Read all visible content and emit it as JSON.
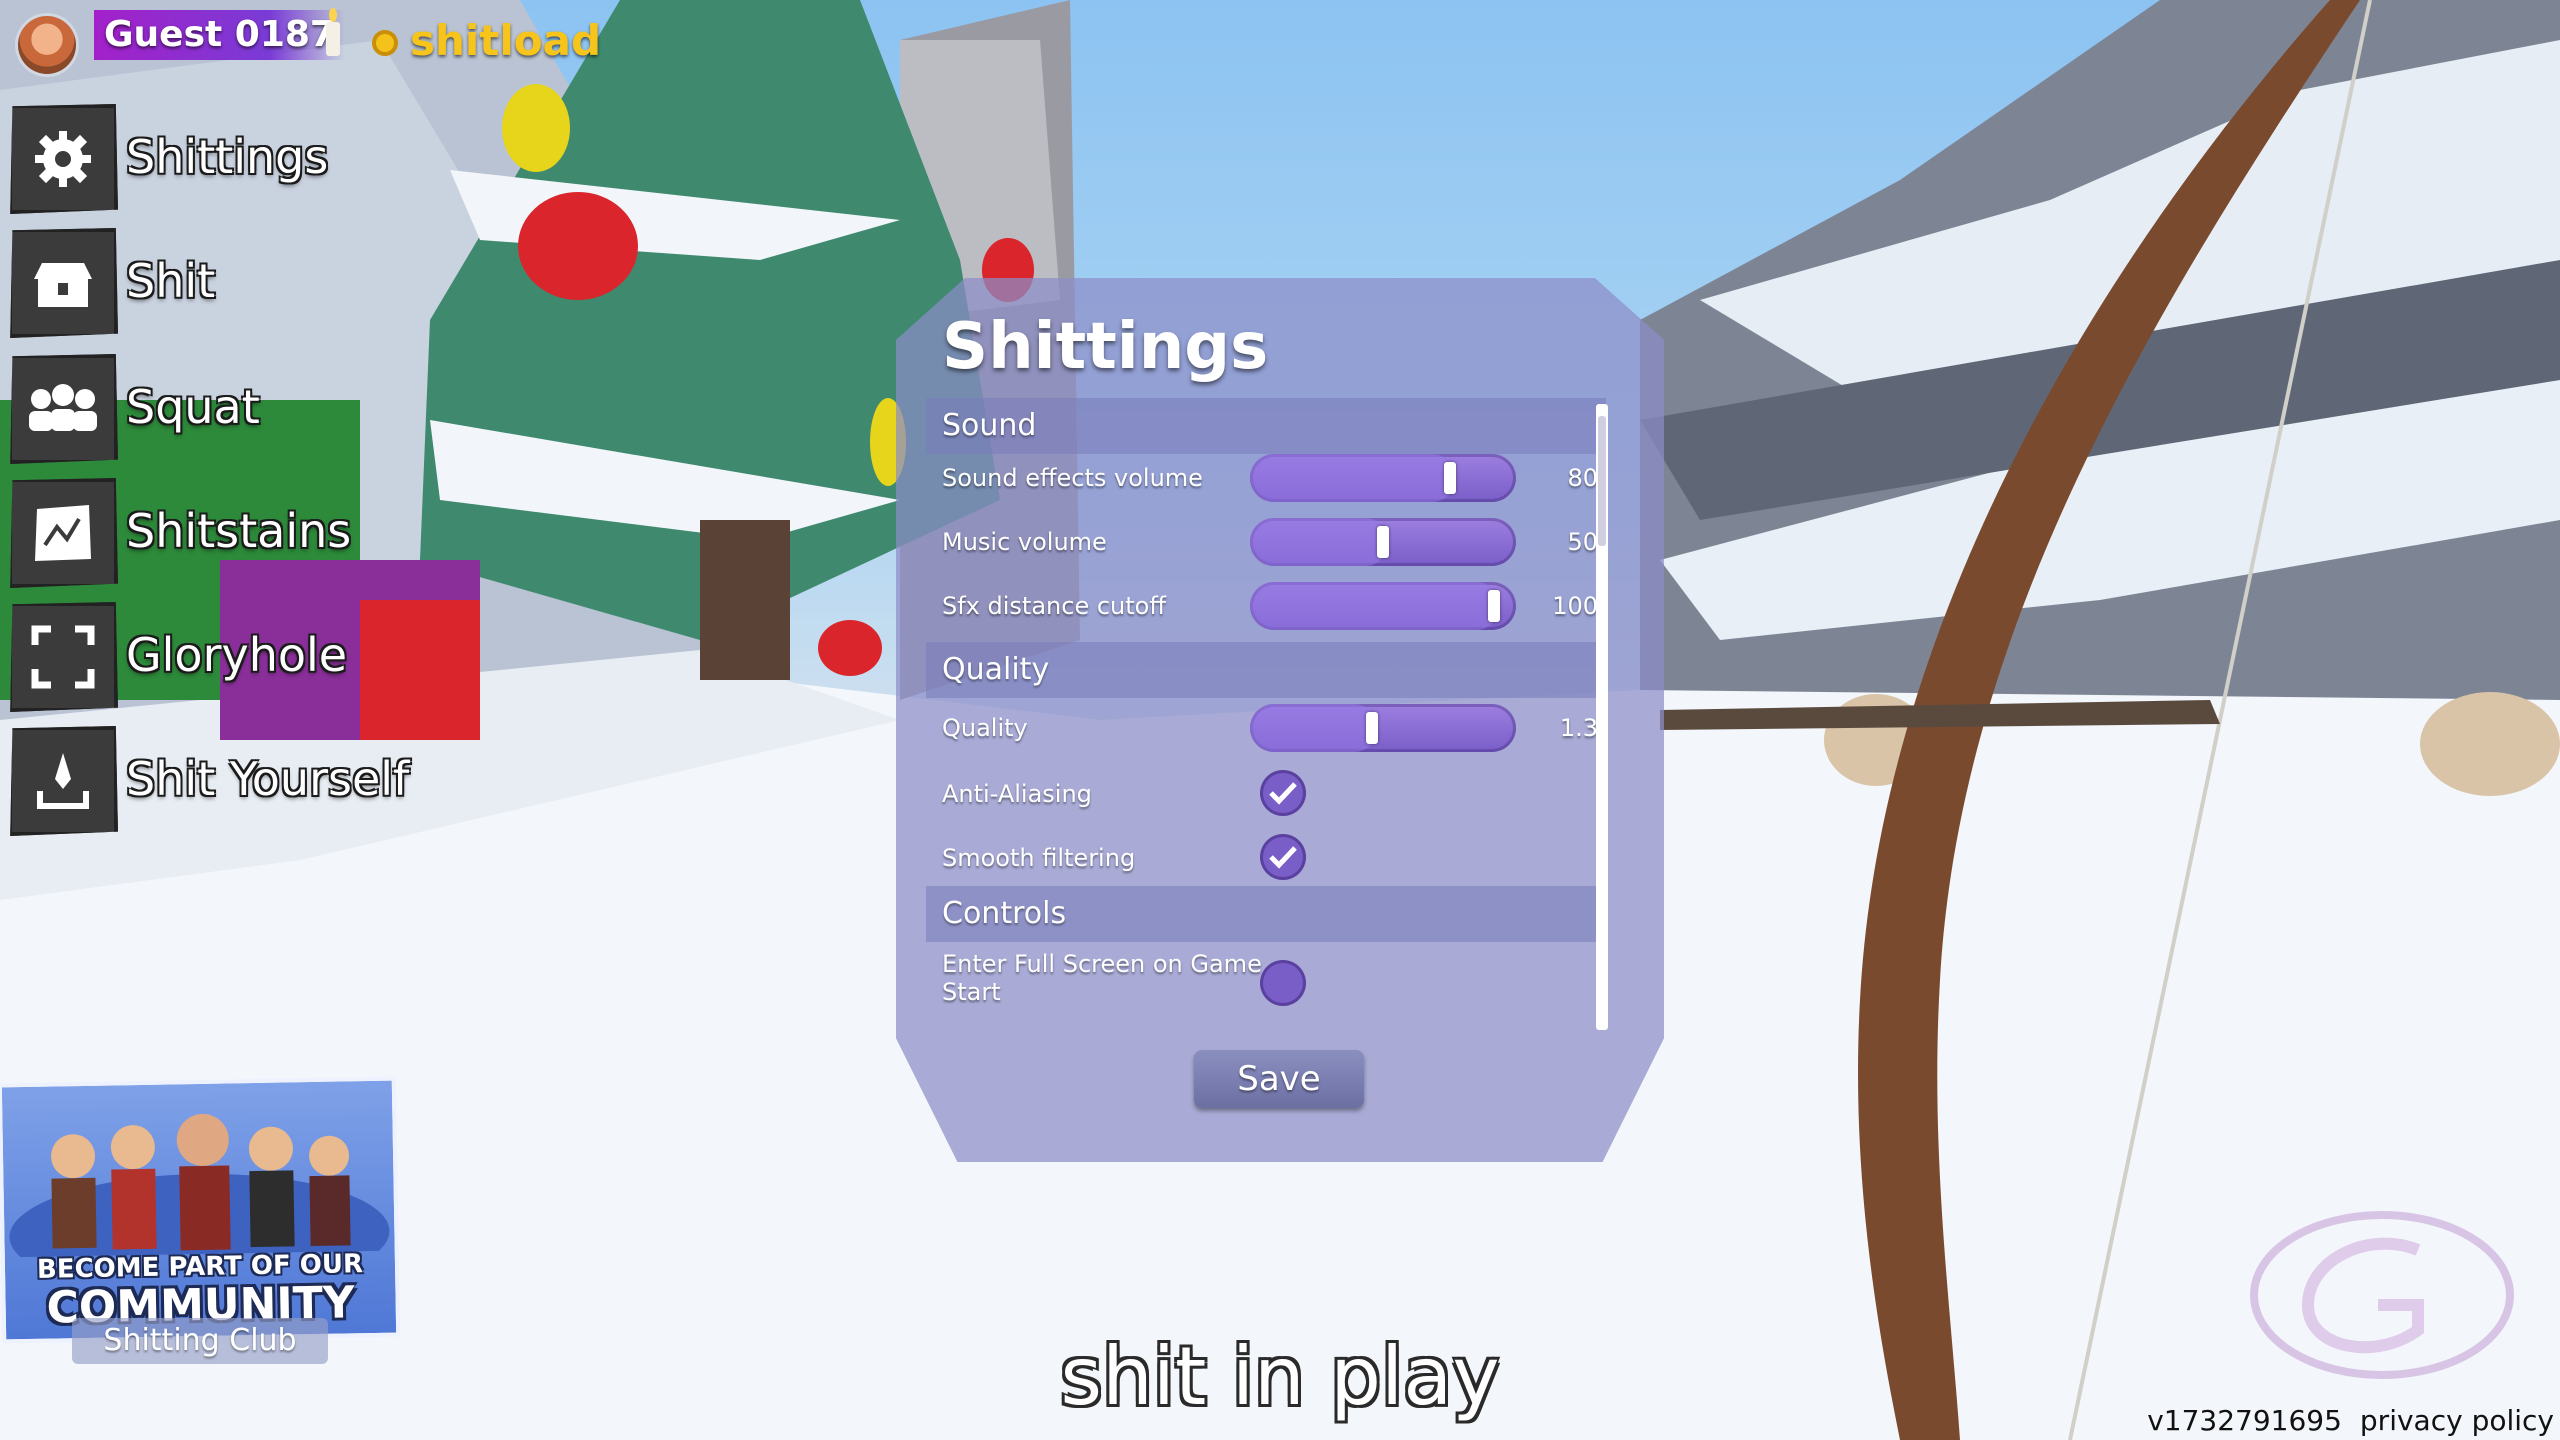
{
  "hud": {
    "username": "Guest 0187",
    "currency": "shitload"
  },
  "menu": [
    {
      "label": "Shittings",
      "icon": "gear-icon"
    },
    {
      "label": "Shit",
      "icon": "chest-icon"
    },
    {
      "label": "Squat",
      "icon": "squad-icon"
    },
    {
      "label": "Shitstains",
      "icon": "map-icon"
    },
    {
      "label": "Gloryhole",
      "icon": "fullscreen-icon"
    },
    {
      "label": "Shit Yourself",
      "icon": "exit-icon"
    }
  ],
  "settings": {
    "title": "Shittings",
    "sections": {
      "sound": "Sound",
      "quality": "Quality",
      "controls": "Controls"
    },
    "sliders": [
      {
        "label": "Sound effects volume",
        "value": "80",
        "level": 0.8
      },
      {
        "label": "Music volume",
        "value": "50",
        "level": 0.5
      },
      {
        "label": "Sfx distance cutoff",
        "value": "100",
        "level": 1.0
      },
      {
        "label": "Quality",
        "value": "1.3",
        "level": 0.45
      }
    ],
    "checkboxes": [
      {
        "label": "Anti-Aliasing",
        "checked": true
      },
      {
        "label": "Smooth filtering",
        "checked": true
      },
      {
        "label": "Enter Full Screen on Game Start",
        "checked": false
      }
    ],
    "save_label": "Save"
  },
  "community": {
    "line1": "BECOME PART OF OUR",
    "line2": "COMMUNITY",
    "club": "Shitting Club"
  },
  "caption": "shit in play",
  "footer": {
    "version": "v1732791695",
    "privacy": "privacy policy"
  },
  "colors": {
    "panel": "#8c8ec8",
    "slider": "#7a5ec8",
    "currency": "#f6c41b",
    "username_bg": "#a320c9"
  }
}
